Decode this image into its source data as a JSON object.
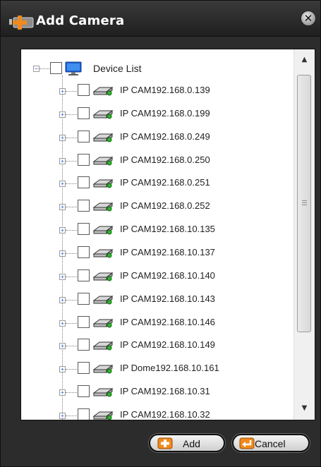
{
  "dialog": {
    "title": "Add Camera"
  },
  "tree": {
    "root_label": "Device List",
    "items": [
      {
        "label": "IP CAM192.168.0.139",
        "icon": "camera-icon"
      },
      {
        "label": "IP CAM192.168.0.199",
        "icon": "camera-icon"
      },
      {
        "label": "IP CAM192.168.0.249",
        "icon": "camera-icon"
      },
      {
        "label": "IP CAM192.168.0.250",
        "icon": "camera-icon"
      },
      {
        "label": "IP CAM192.168.0.251",
        "icon": "camera-icon"
      },
      {
        "label": "IP CAM192.168.0.252",
        "icon": "camera-icon"
      },
      {
        "label": "IP CAM192.168.10.135",
        "icon": "camera-icon"
      },
      {
        "label": "IP CAM192.168.10.137",
        "icon": "camera-icon"
      },
      {
        "label": "IP CAM192.168.10.140",
        "icon": "camera-icon"
      },
      {
        "label": "IP CAM192.168.10.143",
        "icon": "camera-icon"
      },
      {
        "label": "IP CAM192.168.10.146",
        "icon": "camera-icon"
      },
      {
        "label": "IP CAM192.168.10.149",
        "icon": "camera-icon"
      },
      {
        "label": "IP Dome192.168.10.161",
        "icon": "camera-icon"
      },
      {
        "label": "IP CAM192.168.10.31",
        "icon": "camera-icon"
      },
      {
        "label": "IP CAM192.168.10.32",
        "icon": "camera-icon"
      }
    ]
  },
  "buttons": {
    "add_label": "Add",
    "cancel_label": "Cancel"
  },
  "colors": {
    "dialog_bg": "#2c2c2c",
    "accent_orange": "#f08a1c",
    "panel_bg": "#ffffff"
  }
}
